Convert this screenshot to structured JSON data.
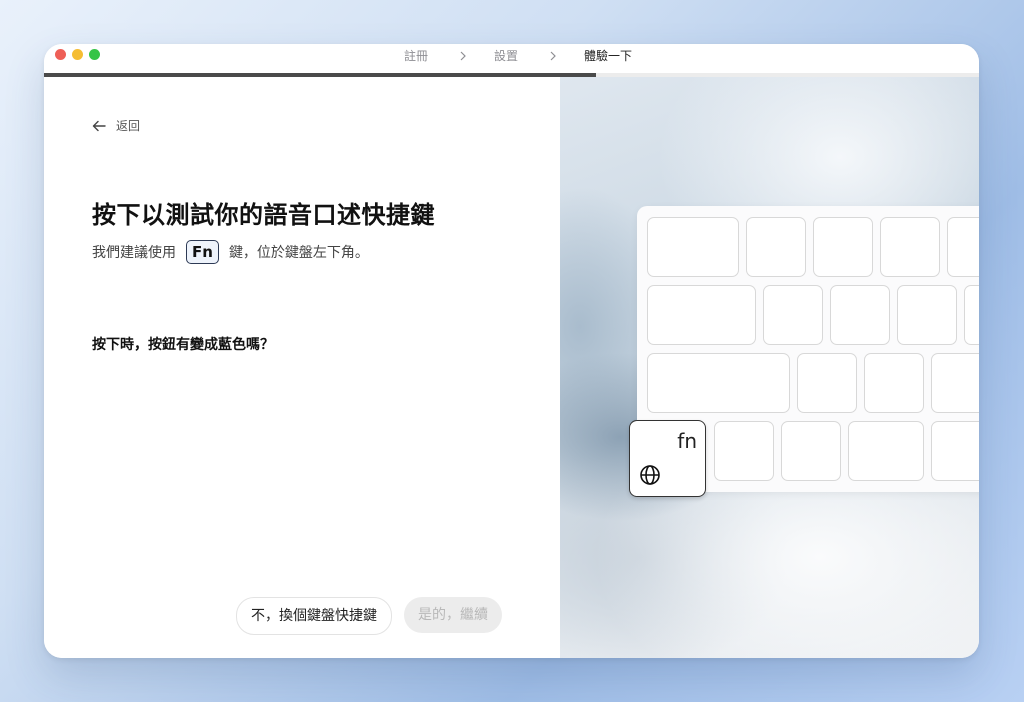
{
  "titlebar": {
    "breadcrumbs": [
      "註冊",
      "設置",
      "體驗一下"
    ],
    "active_index": 2,
    "progress": 0.59
  },
  "back": {
    "label": "返回"
  },
  "main": {
    "heading": "按下以測試你的語音口述快捷鍵",
    "sub_before": "我們建議使用",
    "key_name": "Fn",
    "sub_after": "鍵，位於鍵盤左下角。",
    "question": "按下時，按鈕有變成藍色嗎？"
  },
  "actions": {
    "no_label": "不，換個鍵盤快捷鍵",
    "yes_label": "是的，繼續",
    "yes_enabled": false
  },
  "keyboard": {
    "fn_key_label": "fn",
    "fn_icon": "globe-icon"
  }
}
